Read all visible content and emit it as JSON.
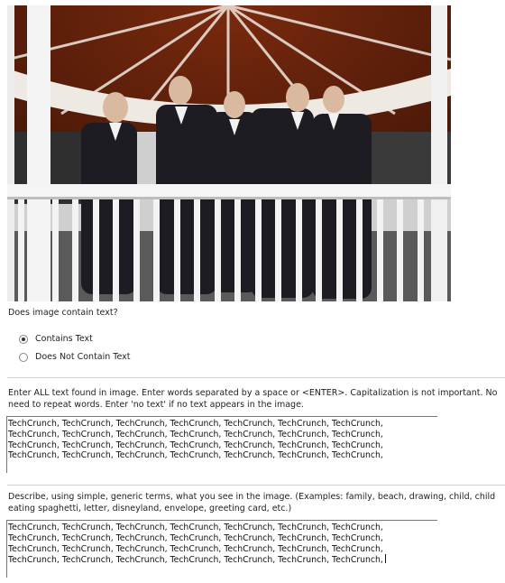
{
  "question": {
    "text": "Does image contain text?"
  },
  "radio_options": [
    {
      "label": "Contains Text",
      "selected": true
    },
    {
      "label": "Does Not Contain Text",
      "selected": false
    }
  ],
  "text_entry": {
    "instructions": "Enter ALL text found in image. Enter words separated by a space or <ENTER>. Capitalization is not important. No need to repeat words. Enter 'no text' if no text appears in the image.",
    "value": "TechCrunch, TechCrunch, TechCrunch, TechCrunch, TechCrunch, TechCrunch, TechCrunch,\nTechCrunch, TechCrunch, TechCrunch, TechCrunch, TechCrunch, TechCrunch, TechCrunch,\nTechCrunch, TechCrunch, TechCrunch, TechCrunch, TechCrunch, TechCrunch, TechCrunch,\nTechCrunch, TechCrunch, TechCrunch, TechCrunch, TechCrunch, TechCrunch, TechCrunch,"
  },
  "describe_entry": {
    "instructions": "Describe, using simple, generic terms, what you see in the image. (Examples: family, beach, drawing, child, child eating spaghetti, letter, disneyland, envelope, greeting card, etc.)",
    "value": "TechCrunch, TechCrunch, TechCrunch, TechCrunch, TechCrunch, TechCrunch, TechCrunch,\nTechCrunch, TechCrunch, TechCrunch, TechCrunch, TechCrunch, TechCrunch, TechCrunch,\nTechCrunch, TechCrunch, TechCrunch, TechCrunch, TechCrunch, TechCrunch, TechCrunch,\nTechCrunch, TechCrunch, TechCrunch, TechCrunch, TechCrunch, TechCrunch, TechCrunch,"
  }
}
